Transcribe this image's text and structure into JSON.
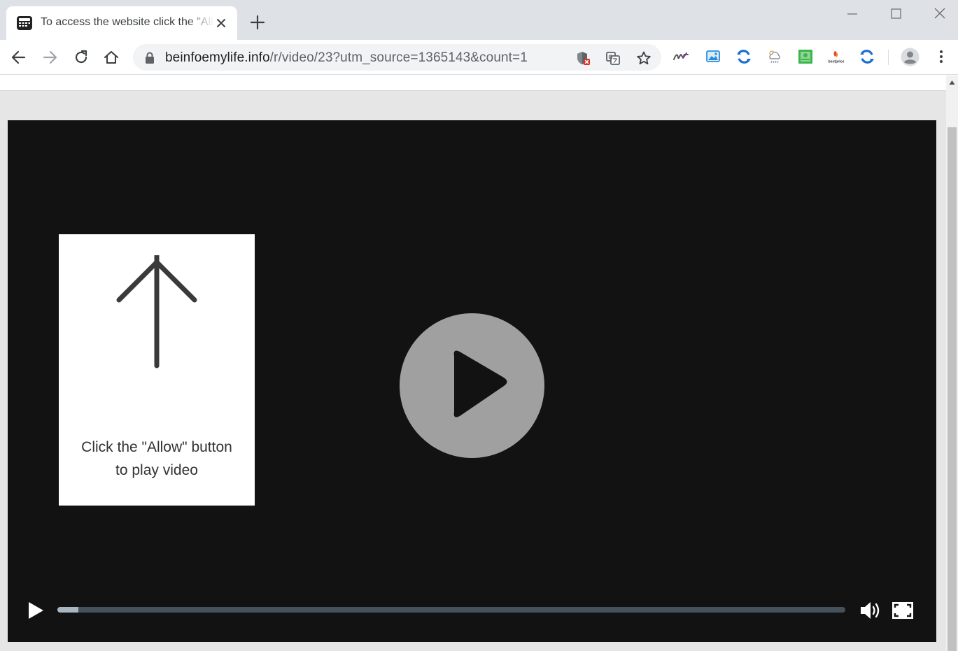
{
  "browser": {
    "tab": {
      "title": "To access the website click the \"Allow\" button",
      "favicon": "video-ad-icon"
    },
    "new_tab_icon": "plus-icon",
    "window_controls": [
      "minimize-icon",
      "maximize-icon",
      "close-icon"
    ],
    "toolbar": {
      "nav_icons": [
        "back-arrow-icon",
        "forward-arrow-icon",
        "reload-icon",
        "home-icon"
      ],
      "address": {
        "host": "beinfoemylife.info",
        "path": "/r/video/23?utm_source=1365143&count=1"
      },
      "omnibox_icons": [
        "blocked-popup-shield-icon",
        "translate-icon",
        "bookmark-star-icon"
      ],
      "extension_icons": [
        "signature-extension-icon",
        "photo-extension-icon",
        "sync-blue-icon",
        "weather-cloud-icon",
        "green-document-icon",
        "bestprice-icon",
        "sync-blue-icon"
      ],
      "extension_labels": {
        "bestprice": "bestprice"
      },
      "profile_icon": "account-avatar-icon",
      "menu_icon": "kebab-menu-icon"
    }
  },
  "page": {
    "allow_prompt": {
      "line1": "Click the \"Allow\" button",
      "line2": "to play video"
    },
    "player": {
      "big_play_icon": "play-circle-icon",
      "progress_fraction": 0.027,
      "controls": [
        "play-icon",
        "volume-icon",
        "fullscreen-icon"
      ]
    }
  },
  "colors": {
    "tab_strip": "#dee1e6",
    "player_bg": "#121212",
    "progress_track": "#45525b",
    "progress_fill": "#a9b6bf",
    "big_play": "#a0a0a0"
  }
}
